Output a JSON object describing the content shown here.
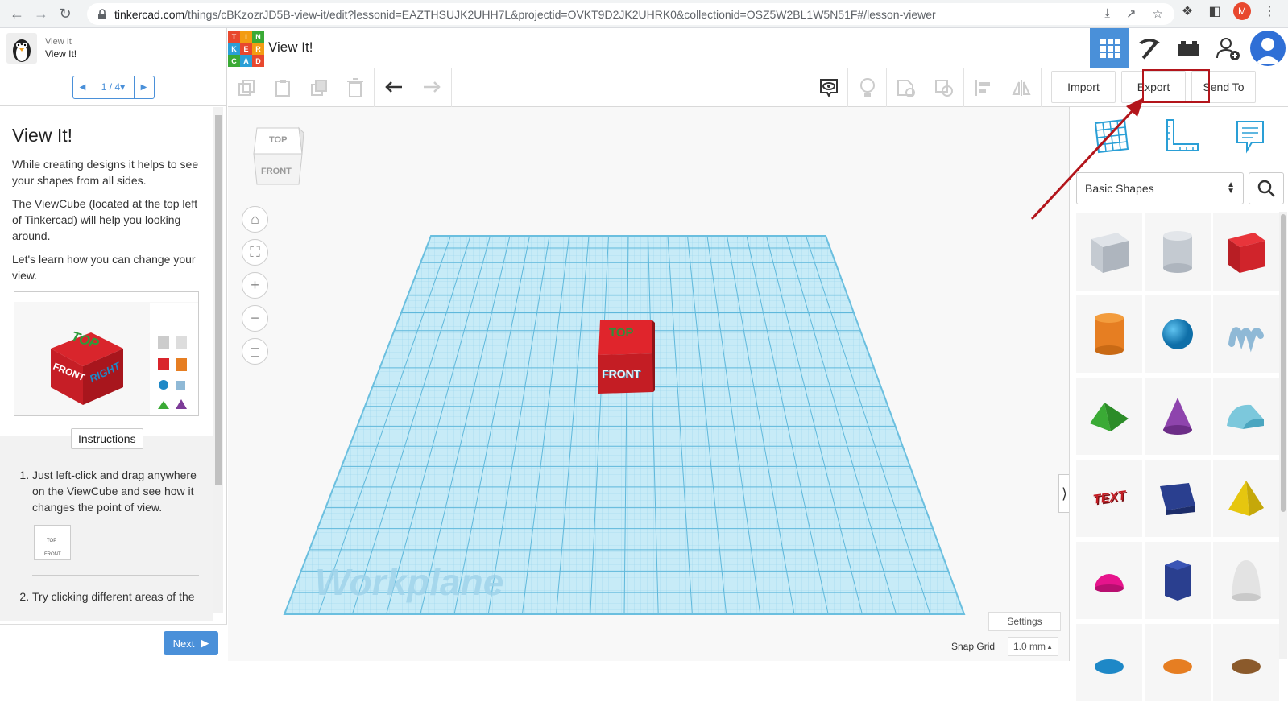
{
  "browser": {
    "url_host": "tinkercad.com",
    "url_path": "/things/cBKzozrJD5B-view-it/edit?lessonid=EAZTHSUJK2UHH7L&projectid=OVKT9D2JK2UHRK0&collectionid=OSZ5W2BL1W5N51F#/lesson-viewer",
    "profile_initial": "M"
  },
  "header": {
    "lesson_category": "View It",
    "lesson_name": "View It!",
    "logo_letters": [
      "T",
      "I",
      "N",
      "K",
      "E",
      "R",
      "C",
      "A",
      "D"
    ],
    "design_title": "View It!"
  },
  "lesson": {
    "pager": "1 / 4",
    "title": "View It!",
    "paragraphs": [
      "While creating designs it helps to see your shapes from all sides.",
      "The ViewCube (located at the top left of Tinkercad) will help you looking around.",
      "Let's learn how you can change your view."
    ],
    "image_labels": {
      "top": "TOP",
      "front": "FRONT",
      "right": "RIGHT"
    },
    "instructions_label": "Instructions",
    "steps": [
      "Just left-click and drag anywhere on the ViewCube and see how it changes the point of view.",
      "Try clicking different areas of the"
    ],
    "thumb_top": "TOP",
    "thumb_front": "FRONT",
    "next_label": "Next"
  },
  "toolbar": {
    "import_label": "Import",
    "export_label": "Export",
    "send_to_label": "Send To"
  },
  "viewport": {
    "viewcube_top": "TOP",
    "viewcube_front": "FRONT",
    "cube_top_label": "TOP",
    "cube_front_label": "FRONT",
    "workplane_label": "Workplane",
    "settings_label": "Settings",
    "snap_grid_label": "Snap Grid",
    "snap_grid_value": "1.0 mm"
  },
  "shapes_panel": {
    "category": "Basic Shapes",
    "text_shape_label": "TEXT"
  },
  "colors": {
    "accent_blue": "#4a90d9",
    "annotation_red": "#b3151b",
    "grid_blue": "#a9dbee"
  }
}
